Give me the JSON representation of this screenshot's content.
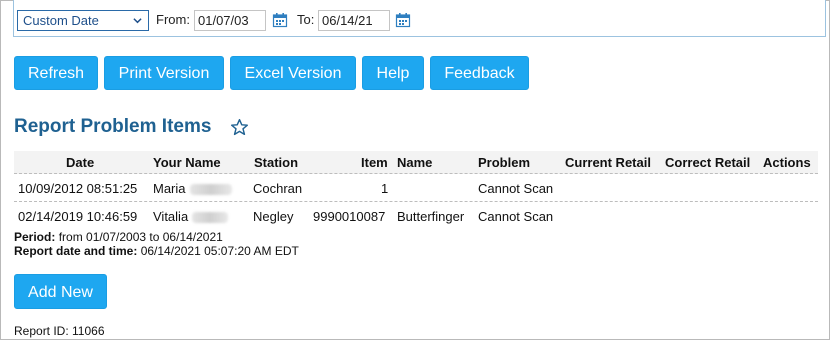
{
  "filter": {
    "range_select": "Custom Date",
    "from_label": "From:",
    "from_value": "01/07/03",
    "to_label": "To:",
    "to_value": "06/14/21"
  },
  "toolbar": {
    "refresh": "Refresh",
    "print": "Print Version",
    "excel": "Excel Version",
    "help": "Help",
    "feedback": "Feedback"
  },
  "report": {
    "title": "Report Problem Items",
    "columns": [
      "Date",
      "Your Name",
      "Station",
      "Item",
      "Name",
      "Problem",
      "Current Retail",
      "Correct Retail",
      "Actions"
    ],
    "rows": [
      {
        "date": "10/09/2012 08:51:25",
        "your_name": "Maria",
        "station": "Cochran",
        "item": "1",
        "name": "",
        "problem": "Cannot Scan",
        "current_retail": "",
        "correct_retail": "",
        "actions": ""
      },
      {
        "date": "02/14/2019 10:46:59",
        "your_name": "Vitalia",
        "station": "Negley",
        "item": "9990010087",
        "name": "Butterfinger",
        "problem": "Cannot Scan",
        "current_retail": "",
        "correct_retail": "",
        "actions": ""
      }
    ],
    "period_label": "Period:",
    "period_value": "from 01/07/2003 to 06/14/2021",
    "datetime_label": "Report date and time:",
    "datetime_value": "06/14/2021 05:07:20 AM EDT",
    "add_new": "Add New",
    "report_id": "Report ID: 11066"
  },
  "colors": {
    "button": "#1ea7f0",
    "title": "#1f6191",
    "select_text": "#1e4f8a"
  },
  "icons": [
    "chevron-down-icon",
    "calendar-icon",
    "star-outline-icon"
  ]
}
